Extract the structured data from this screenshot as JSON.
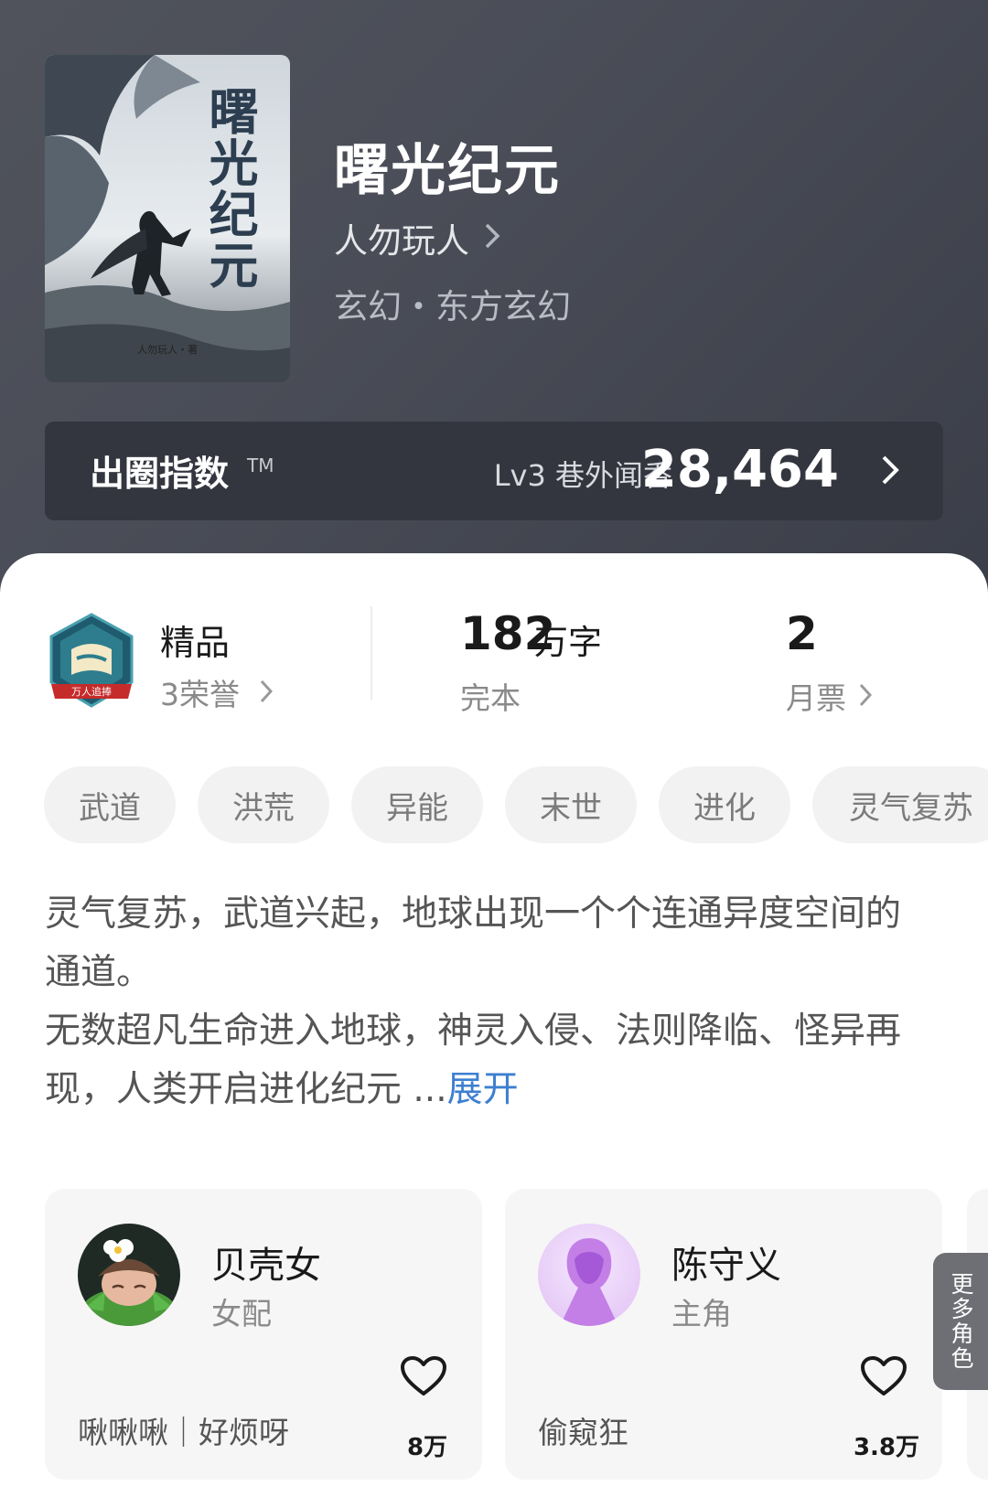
{
  "book": {
    "title": "曙光纪元",
    "author": "人勿玩人",
    "genre": "玄幻・东方玄幻",
    "cover_title": "曙光纪元",
    "cover_author": "人勿玩人・著"
  },
  "index_bar": {
    "label": "出圈指数",
    "tm": "TM",
    "level": "Lv3 巷外闻香",
    "value": "28,464"
  },
  "stats": {
    "quality": "精品",
    "honors": "3荣誉",
    "badge_text": "万人追捧",
    "words_number": "182",
    "words_unit": "万字",
    "status": "完本",
    "tickets_number": "2",
    "tickets_label": "月票"
  },
  "tags": [
    "武道",
    "洪荒",
    "异能",
    "末世",
    "进化",
    "灵气复苏"
  ],
  "description": {
    "para1": "灵气复苏，武道兴起，地球出现一个个连通异度空间的通道。",
    "para2": "无数超凡生命进入地球，神灵入侵、法则降临、怪异再现，人类开启进化纪元 ...",
    "expand": "展开"
  },
  "roles": [
    {
      "name": "贝壳女",
      "type": "女配",
      "desc": "啾啾啾｜好烦呀",
      "likes": "8万"
    },
    {
      "name": "陈守义",
      "type": "主角",
      "desc": "偷窥狂",
      "likes": "3.8万"
    }
  ],
  "more_roles": "更多角色",
  "colors": {
    "hero_bg": "#4a4d57",
    "index_bg": "#33363f",
    "link_blue": "#3d7fd0",
    "tag_bg": "#f2f2f2"
  }
}
